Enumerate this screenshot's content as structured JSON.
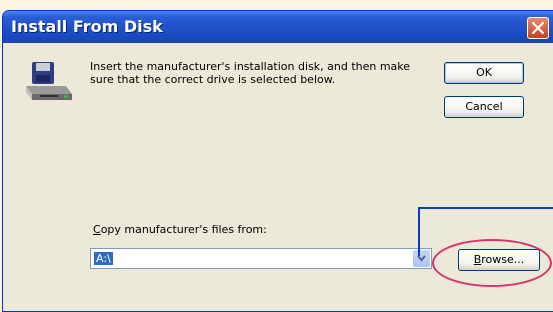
{
  "window": {
    "title": "Install From Disk"
  },
  "instructions": "Insert the manufacturer's installation disk, and then make sure that the correct drive is selected below.",
  "buttons": {
    "ok": "OK",
    "cancel": "Cancel",
    "browse": "Browse..."
  },
  "copy_from": {
    "label_accesskey": "C",
    "label_rest": "opy manufacturer's files from:",
    "value": "A:\\"
  },
  "icons": {
    "close": "close-icon",
    "setup": "disk-drive-setup-icon",
    "dropdown": "chevron-down-icon"
  },
  "colors": {
    "titlebar": "#1e50c8",
    "dialog_bg": "#ece9d8",
    "selection": "#316ac5",
    "annotation_ring": "#d8336c",
    "annotation_line": "#0a3fbd"
  }
}
